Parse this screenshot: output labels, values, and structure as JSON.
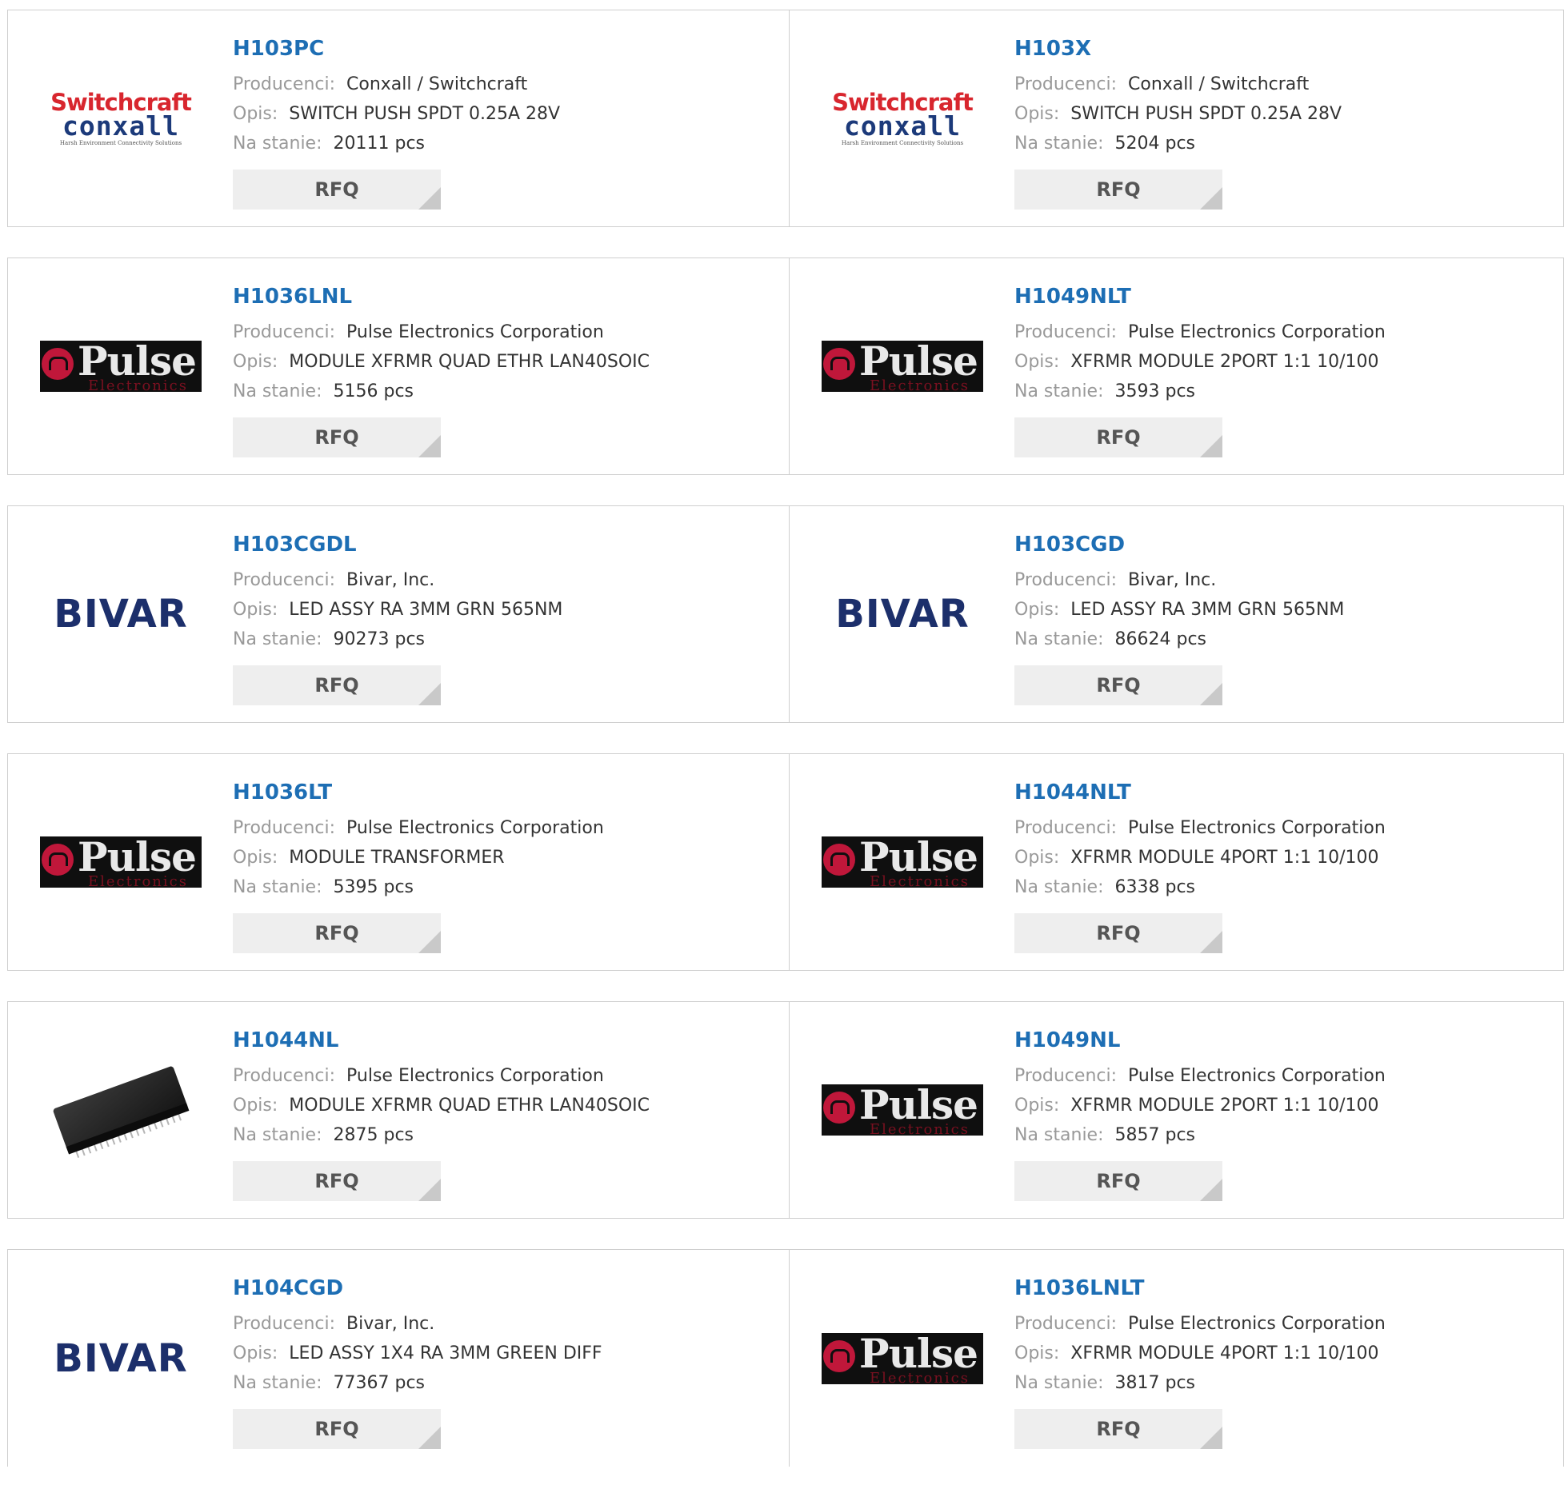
{
  "labels": {
    "manufacturer": "Producenci:",
    "description": "Opis:",
    "stock": "Na stanie:",
    "rfq": "RFQ"
  },
  "logo_text": {
    "switchcraft_top": "Switchcraft",
    "switchcraft_mid": "conxall",
    "switchcraft_tag": "Harsh Environment Connectivity Solutions",
    "pulse_word": "Pulse",
    "pulse_sub": "Electronics",
    "bivar": "BIVAR"
  },
  "colors": {
    "part_link": "#1d6eb4",
    "rfq_bg": "#eeeeee",
    "border": "#cfcfcf"
  },
  "rows": [
    [
      {
        "part": "H103PC",
        "logo": "switchcraft",
        "manufacturer": "Conxall / Switchcraft",
        "description": "SWITCH PUSH SPDT 0.25A 28V",
        "stock": "20111 pcs"
      },
      {
        "part": "H103X",
        "logo": "switchcraft",
        "manufacturer": "Conxall / Switchcraft",
        "description": "SWITCH PUSH SPDT 0.25A 28V",
        "stock": "5204 pcs"
      }
    ],
    [
      {
        "part": "H1036LNL",
        "logo": "pulse",
        "manufacturer": "Pulse Electronics Corporation",
        "description": "MODULE XFRMR QUAD ETHR LAN40SOIC",
        "stock": "5156 pcs"
      },
      {
        "part": "H1049NLT",
        "logo": "pulse",
        "manufacturer": "Pulse Electronics Corporation",
        "description": "XFRMR MODULE 2PORT 1:1 10/100",
        "stock": "3593 pcs"
      }
    ],
    [
      {
        "part": "H103CGDL",
        "logo": "bivar",
        "manufacturer": "Bivar, Inc.",
        "description": "LED ASSY RA 3MM GRN 565NM",
        "stock": "90273 pcs"
      },
      {
        "part": "H103CGD",
        "logo": "bivar",
        "manufacturer": "Bivar, Inc.",
        "description": "LED ASSY RA 3MM GRN 565NM",
        "stock": "86624 pcs"
      }
    ],
    [
      {
        "part": "H1036LT",
        "logo": "pulse",
        "manufacturer": "Pulse Electronics Corporation",
        "description": "MODULE TRANSFORMER",
        "stock": "5395 pcs"
      },
      {
        "part": "H1044NLT",
        "logo": "pulse",
        "manufacturer": "Pulse Electronics Corporation",
        "description": "XFRMR MODULE 4PORT 1:1 10/100",
        "stock": "6338 pcs"
      }
    ],
    [
      {
        "part": "H1044NL",
        "logo": "chip-photo",
        "manufacturer": "Pulse Electronics Corporation",
        "description": "MODULE XFRMR QUAD ETHR LAN40SOIC",
        "stock": "2875 pcs"
      },
      {
        "part": "H1049NL",
        "logo": "pulse",
        "manufacturer": "Pulse Electronics Corporation",
        "description": "XFRMR MODULE 2PORT 1:1 10/100",
        "stock": "5857 pcs"
      }
    ],
    [
      {
        "part": "H104CGD",
        "logo": "bivar",
        "manufacturer": "Bivar, Inc.",
        "description": "LED ASSY 1X4 RA 3MM GREEN DIFF",
        "stock": "77367 pcs"
      },
      {
        "part": "H1036LNLT",
        "logo": "pulse",
        "manufacturer": "Pulse Electronics Corporation",
        "description": "XFRMR MODULE 4PORT 1:1 10/100",
        "stock": "3817 pcs"
      }
    ]
  ]
}
